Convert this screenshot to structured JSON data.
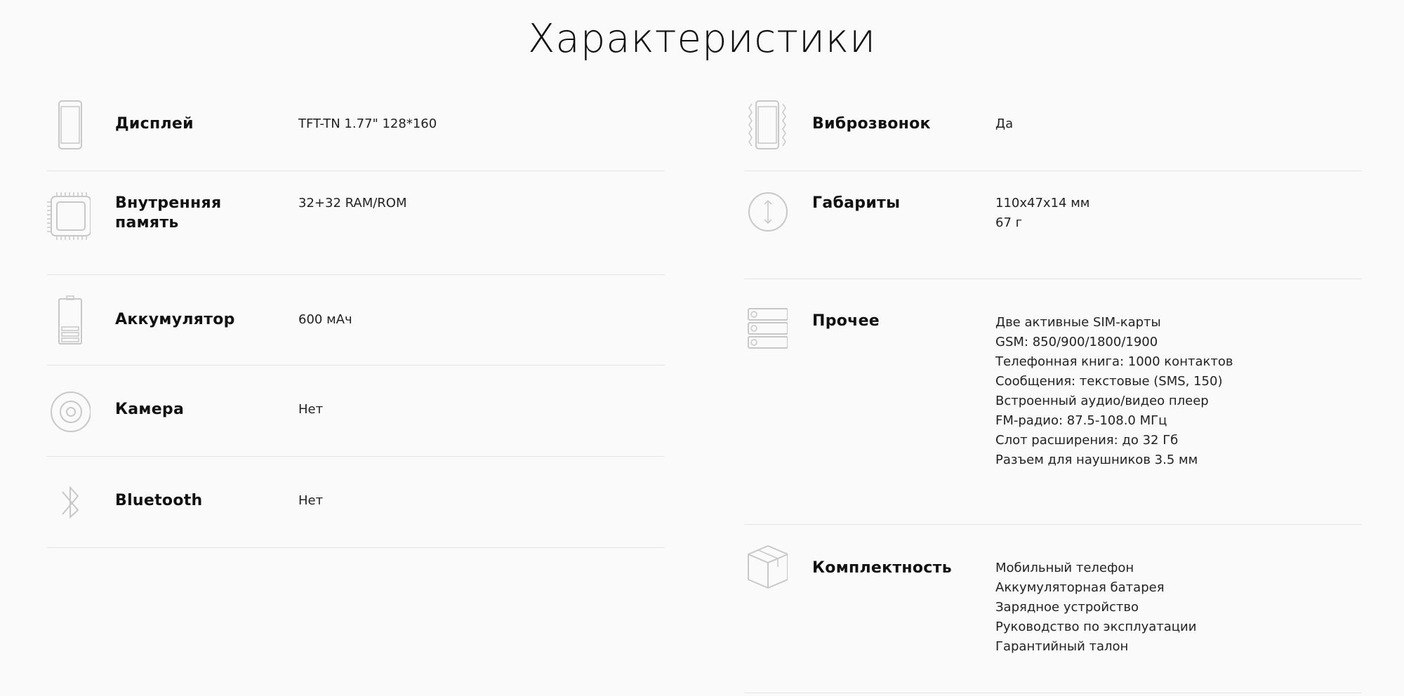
{
  "page": {
    "title": "Характеристики"
  },
  "left": [
    {
      "label": "Дисплей",
      "value": [
        "TFT-TN 1.77\" 128*160"
      ],
      "icon": "phone-icon"
    },
    {
      "label": "Внутренняя память",
      "value": [
        "32+32 RAM/ROM"
      ],
      "icon": "chip-icon"
    },
    {
      "label": "Аккумулятор",
      "value": [
        "600 мАч"
      ],
      "icon": "battery-icon"
    },
    {
      "label": "Камера",
      "value": [
        "Нет"
      ],
      "icon": "camera-icon"
    },
    {
      "label": "Bluetooth",
      "value": [
        "Нет"
      ],
      "icon": "bluetooth-icon"
    }
  ],
  "right": [
    {
      "label": "Виброзвонок",
      "value": [
        "Да"
      ],
      "icon": "vibration-icon"
    },
    {
      "label": "Габариты",
      "value": [
        "110x47x14 мм",
        "67 г"
      ],
      "icon": "dimensions-icon"
    },
    {
      "label": "Прочее",
      "value": [
        "Две активные SIM-карты",
        "GSM: 850/900/1800/1900",
        "Телефонная книга: 1000 контактов",
        "Сообщения: текстовые (SMS, 150)",
        "Встроенный аудио/видео плеер",
        "FM-радио: 87.5-108.0 МГц",
        "Слот расширения: до 32 Гб",
        "Разъем для наушников 3.5 мм"
      ],
      "icon": "list-icon"
    },
    {
      "label": "Комплектность",
      "value": [
        "Мобильный телефон",
        "Аккумуляторная батарея",
        "Зарядное устройство",
        "Руководство по эксплуатации",
        "Гарантийный талон"
      ],
      "icon": "box-icon"
    }
  ]
}
